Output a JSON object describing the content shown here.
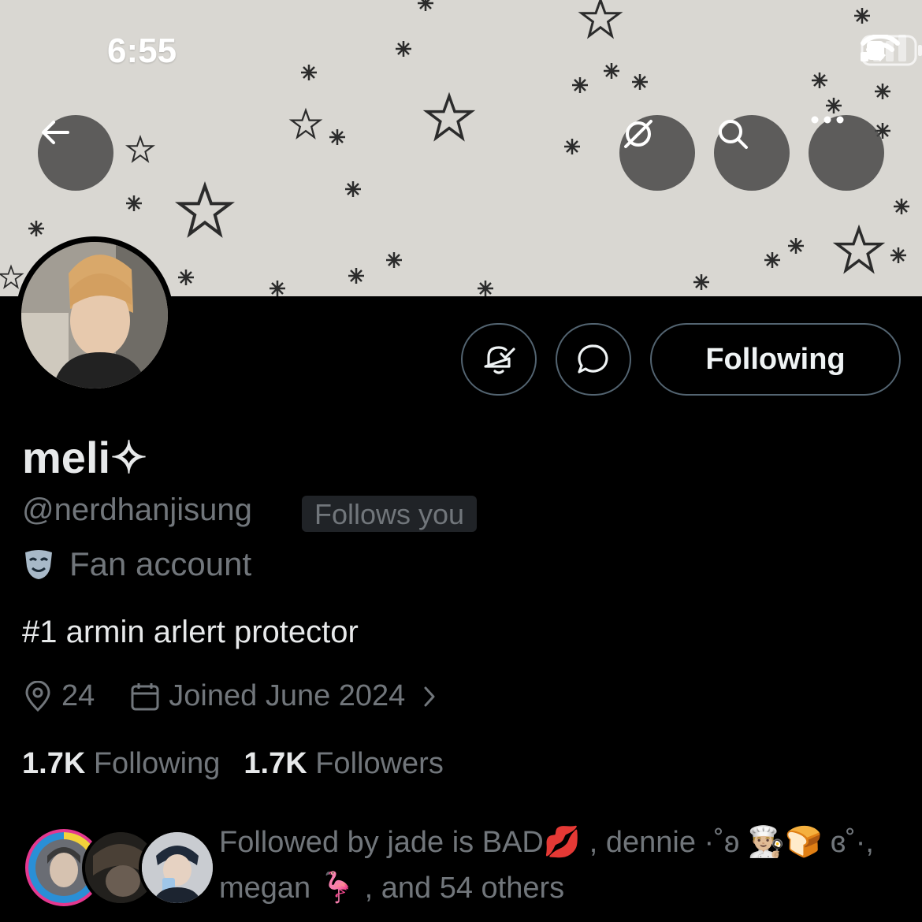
{
  "status_bar": {
    "time": "6:55"
  },
  "profile": {
    "display_name": "meli✧",
    "handle": "@nerdhanjisung",
    "follows_you_badge": "Follows you",
    "category": "Fan account",
    "bio": "#1 armin arlert protector",
    "location": "24",
    "joined": "Joined June 2024",
    "following_count": "1.7K",
    "following_label": "Following",
    "followers_count": "1.7K",
    "followers_label": "Followers"
  },
  "actions": {
    "following_button": "Following"
  },
  "followed_by": {
    "line1": "Followed by jade is BAD💋 , dennie ·˚ʚ 👨🏼‍🍳🍞 ɞ˚·,",
    "line2": "megan 🦩 , and 54 others"
  },
  "icons": {
    "back": "back-arrow-icon",
    "grok": "grok-icon",
    "search": "search-icon",
    "more": "more-icon",
    "notify": "bell-check-icon",
    "message": "chat-bubble-icon",
    "location": "location-pin-icon",
    "calendar": "calendar-icon",
    "chevron": "chevron-right-icon",
    "category": "theater-mask-icon"
  }
}
